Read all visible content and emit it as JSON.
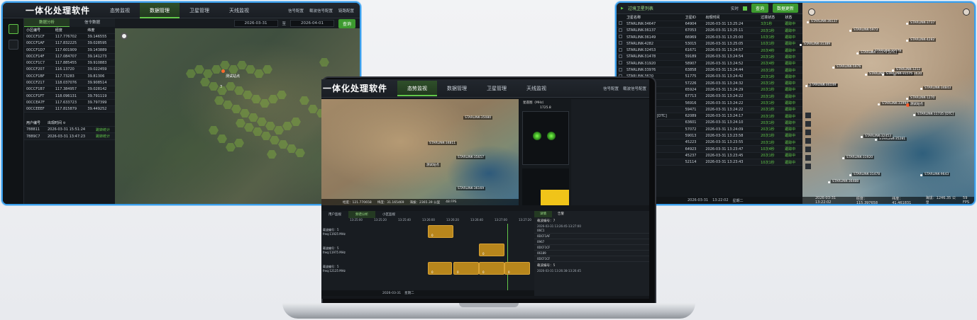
{
  "left_window": {
    "app_title": "一体化处理软件",
    "nav_tabs": [
      "态势监视",
      "数据管理",
      "卫星管理",
      "天线监视"
    ],
    "active_tab": "数据管理",
    "toolbar": {
      "signal_compare": "信号配置",
      "beam_config": "载波信号配置",
      "link_config": "链路配置"
    },
    "date_start": "2026-03-31",
    "date_sep": "至",
    "date_end": "2026-04-01",
    "query_label": "查询",
    "sub_tabs": [
      "数据分析",
      "信令数据"
    ],
    "cell_table": {
      "headers": [
        "小区编号",
        "经度",
        "纬度"
      ],
      "rows": [
        [
          "00CCF1CF",
          "117.776702",
          "39.146555"
        ],
        [
          "00CCF1AF",
          "117.832225",
          "39.028595"
        ],
        [
          "00CCF1D7",
          "117.601909",
          "39.143889"
        ],
        [
          "00CCF14F",
          "117.084707",
          "39.141273"
        ],
        [
          "00CCF1C7",
          "117.885455",
          "39.910883"
        ],
        [
          "00CCF207",
          "116.13720",
          "39.022459"
        ],
        [
          "00CCF1BF",
          "117.73283",
          "39.81306"
        ],
        [
          "00CCF217",
          "118.037076",
          "39.908514"
        ],
        [
          "00CCF1B7",
          "117.384957",
          "39.028142"
        ],
        [
          "00CCF1FT",
          "118.096131",
          "39.791119"
        ],
        [
          "00CCEA7F",
          "117.633723",
          "39.797399"
        ],
        [
          "00CCEEEF",
          "117.815879",
          "39.449252"
        ]
      ]
    },
    "user_table": {
      "headers": [
        "用户编号",
        "出现时间 ≎"
      ],
      "rows": [
        [
          "788811",
          "2026-03-31 15:51:24",
          "跳转统计"
        ],
        [
          "7889C7",
          "2026-03-31 13:47:23",
          "跳转统计"
        ]
      ]
    },
    "map_label": "测试站点",
    "map_count": "3"
  },
  "laptop": {
    "app_title": "一体化处理软件",
    "nav_tabs": [
      "态势监视",
      "数据管理",
      "卫星管理",
      "天线监视"
    ],
    "active_tab": "态势监视",
    "toolbar": {
      "signal_compare": "信号配置",
      "beam_config": "载波信号配置"
    },
    "map_labels": [
      "STARLINK-35080",
      "STARLINK-34811",
      "STARLINK-35657",
      "STARLINK-36169",
      "测试站点"
    ],
    "scatter_title": "星座图（MHz）",
    "scatter_value": "1725.8",
    "map_status": [
      "经度：121.770658",
      "纬度：31.165469",
      "海拔：2365.39 公里",
      "48 FPS"
    ],
    "timeline": {
      "tabs": [
        "用户监视",
        "频谱分析",
        "小区监视"
      ],
      "active_tab": "频谱分析",
      "rows": [
        {
          "label": "载波编号：5",
          "sub": "freq:11925 MHz"
        },
        {
          "label": "载波编号：5",
          "sub": "freq:11975 MHz"
        },
        {
          "label": "载波编号：5",
          "sub": "freq:12125 MHz"
        }
      ],
      "ticks": [
        "13:25:00",
        "13:25:20",
        "13:25:40",
        "13:26:00",
        "13:26:20",
        "13:26:40",
        "13:27:00",
        "13:27:20"
      ],
      "block_text": "0",
      "time_marker": "13:27:06"
    },
    "right_panel": {
      "tabs": [
        "详情",
        "告警"
      ],
      "beam_label": "载波编号：7",
      "time_range": "2026-03-31 13:26:45-13:27:00",
      "items": [
        "06C1",
        "0DCF1AF",
        "0967",
        "0DCF1CF",
        "06189",
        "0DCF1CF"
      ],
      "beam_label2": "载波编号：5",
      "time_range2": "2026-03-31 13:26:38-13:26:45",
      "badge1": "小区：1",
      "badge2": "用户：1"
    },
    "footer_date": "2026-03-31",
    "footer_day": "星期二"
  },
  "right_window": {
    "title": "过境卫星列表",
    "realtime_label": "实时",
    "query_label": "查询",
    "refresh_label": "数据更新",
    "headers": [
      "卫星名称",
      "卫星ID",
      "出现时间",
      "过境状态",
      "状态"
    ],
    "rows": [
      [
        "STARLINK-34647",
        "64904",
        "2026-03-31 13:25:24",
        "3次1秒",
        "跟踪中"
      ],
      [
        "STARLINK-36137",
        "67053",
        "2026-03-31 13:25:11",
        "20次1秒",
        "跟踪中"
      ],
      [
        "STARLINK-36149",
        "66969",
        "2026-03-31 13:25:00",
        "10次1秒",
        "跟踪中"
      ],
      [
        "STARLINK-4282",
        "53015",
        "2026-03-31 13:25:05",
        "10次1秒",
        "跟踪中"
      ],
      [
        "STARLINK-32453",
        "61671",
        "2026-03-31 13:24:57",
        "20次4秒",
        "跟踪中"
      ],
      [
        "STARLINK-31478",
        "59189",
        "2026-03-31 13:24:54",
        "20次1秒",
        "跟踪中"
      ],
      [
        "STARLINK-31920",
        "58907",
        "2026-03-31 13:24:52",
        "20次4秒",
        "跟踪中"
      ],
      [
        "STARLINK-33976",
        "63858",
        "2026-03-31 13:24:44",
        "20次1秒",
        "跟踪中"
      ],
      [
        "STARLINK-3620",
        "51775",
        "2026-03-31 13:24:42",
        "20次1秒",
        "跟踪中"
      ],
      [
        "STARLINK-6350",
        "57226",
        "2026-03-31 13:24:32",
        "20次1秒",
        "跟踪中"
      ],
      [
        "STARLINK-35281",
        "65924",
        "2026-03-31 13:24:29",
        "20次1秒",
        "跟踪中"
      ],
      [
        "STARLINK-36708",
        "67713",
        "2026-03-31 13:24:22",
        "20次1秒",
        "跟踪中"
      ],
      [
        "STARLINK-5973",
        "56916",
        "2026-03-31 13:24:22",
        "20次1秒",
        "跟踪中"
      ],
      [
        "STARLINK-31575",
        "59471",
        "2026-03-31 13:24:22",
        "20次1秒",
        "跟踪中"
      ],
      [
        "STARLINK-11379 [DTC]",
        "62089",
        "2026-03-31 13:24:17",
        "20次1秒",
        "跟踪中"
      ],
      [
        "STARLINK-33884",
        "63601",
        "2026-03-31 13:24:10",
        "20次1秒",
        "跟踪中"
      ],
      [
        "STARLINK-5643",
        "57072",
        "2026-03-31 13:24:09",
        "20次1秒",
        "跟踪中"
      ],
      [
        "STARLINK-31389",
        "59013",
        "2026-03-31 13:23:58",
        "20次1秒",
        "跟踪中"
      ],
      [
        "STARLINK-1212",
        "45223",
        "2026-03-31 13:23:55",
        "20次1秒",
        "跟踪中"
      ],
      [
        "STARLINK-34843",
        "64923",
        "2026-03-31 13:23:47",
        "10次4秒",
        "跟踪中"
      ],
      [
        "STARLINK-1270",
        "45237",
        "2026-03-31 13:23:45",
        "20次1秒",
        "跟踪中"
      ],
      [
        "STARLINK-3737",
        "52114",
        "2026-03-31 13:23:43",
        "10次1秒",
        "跟踪中"
      ]
    ],
    "footer_date": "2026-03-31",
    "footer_time": "13:22:02",
    "footer_day": "星期二",
    "map_labels": [
      "STARLINK-36137",
      "STARLINK-5973",
      "STARLINK-3737",
      "STARLINK-4282",
      "STARLINK-31389",
      "STARLINK-31579",
      "STARLINK-11379 [DTC]",
      "STARLINK-3620",
      "STARLINK-4282",
      "STARLINK-3630",
      "STARLINK-5976",
      "STARLINK-31575",
      "STARLINK-1212",
      "STARLINK-36149",
      "STARLINK-34843",
      "STARLINK-1270",
      "STARLINK-33994",
      "STARLINK-11735 [DTC]",
      "STARLINK-35281",
      "STARLINK-31920",
      "STARLINK-31478",
      "STARLINK-36488",
      "STARLINK-32453",
      "STARLINK-9643",
      "测试站点"
    ],
    "map_status": [
      "2026-03-31 13:22:02",
      "经度：115.397658",
      "纬度：41.461831",
      "海拔：1246.35 公里",
      "59 FPS"
    ]
  },
  "colors": {
    "accent": "#62c84a",
    "frame": "#3b9eea",
    "amber": "#b8861c"
  }
}
